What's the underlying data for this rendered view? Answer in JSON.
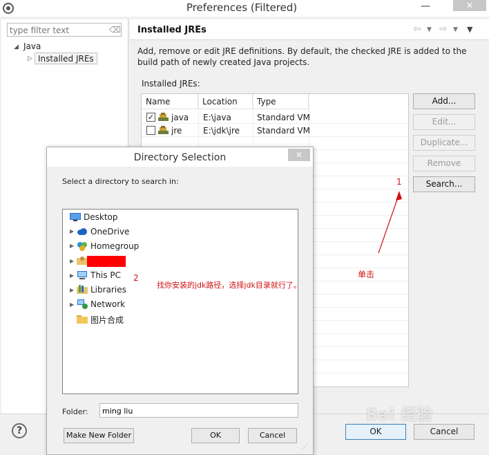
{
  "window": {
    "title": "Preferences (Filtered)",
    "close_glyph": "✕",
    "minimize_glyph": "—"
  },
  "left_pane": {
    "filter_placeholder": "type filter text",
    "tree": [
      {
        "label": "Java",
        "expanded": true
      },
      {
        "label": "Installed JREs",
        "selected": true
      }
    ]
  },
  "page": {
    "title": "Installed JREs",
    "description": "Add, remove or edit JRE definitions. By default, the checked JRE is added to the build path of newly created Java projects.",
    "installed_label": "Installed JREs:"
  },
  "table": {
    "columns": [
      "Name",
      "Location",
      "Type"
    ],
    "rows": [
      {
        "checked": true,
        "name": "java",
        "location": "E:\\java",
        "type": "Standard VM"
      },
      {
        "checked": false,
        "name": "jre",
        "location": "E:\\jdk\\jre",
        "type": "Standard VM"
      }
    ]
  },
  "buttons": {
    "add": "Add...",
    "edit": "Edit...",
    "duplicate": "Duplicate...",
    "remove": "Remove",
    "search": "Search...",
    "ok": "OK",
    "cancel": "Cancel",
    "help": "?"
  },
  "dialog": {
    "title": "Directory Selection",
    "close_glyph": "✕",
    "prompt": "Select a directory to search in:",
    "tree": [
      {
        "label": "Desktop",
        "icon": "desktop-icon"
      },
      {
        "label": "OneDrive",
        "icon": "cloud-icon"
      },
      {
        "label": "Homegroup",
        "icon": "homegroup-icon"
      },
      {
        "label": "",
        "icon": "user-folder-icon"
      },
      {
        "label": "This PC",
        "icon": "computer-icon"
      },
      {
        "label": "Libraries",
        "icon": "libraries-icon"
      },
      {
        "label": "Network",
        "icon": "network-icon"
      },
      {
        "label": "图片合成",
        "icon": "folder-icon"
      }
    ],
    "folder_label": "Folder:",
    "folder_value": "ming liu",
    "make_new_folder": "Make New Folder",
    "ok": "OK",
    "cancel": "Cancel"
  },
  "annotations": {
    "step1": "1",
    "step2": "2",
    "click_note": "单击",
    "path_note": "找你安装的jdk路径，选择jdk目录就行了。",
    "color": "#d01010"
  },
  "watermark": "Bai 经验"
}
